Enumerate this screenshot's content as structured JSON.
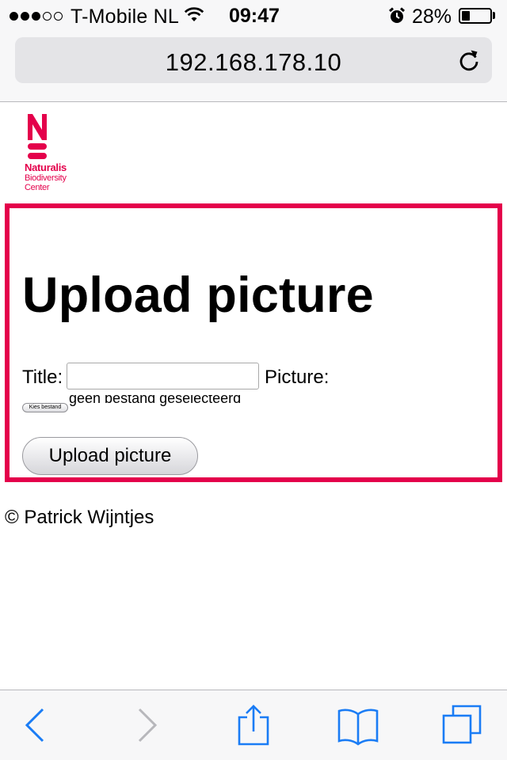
{
  "status_bar": {
    "signal_dots": [
      true,
      true,
      true,
      false,
      false
    ],
    "carrier": "T-Mobile NL",
    "time": "09:47",
    "battery_percent_text": "28%",
    "battery_level": 0.28,
    "icons": [
      "wifi-icon",
      "alarm-icon",
      "battery-icon"
    ]
  },
  "browser": {
    "url": "192.168.178.10",
    "reload_icon": "reload-icon",
    "toolbar_icons": [
      "back-icon",
      "forward-icon",
      "share-icon",
      "bookmarks-icon",
      "tabs-icon"
    ],
    "accent_color": "#1a7cf5",
    "disabled_color": "#b7b7bb"
  },
  "logo": {
    "name": "Naturalis",
    "subtitle_line1": "Biodiversity",
    "subtitle_line2": "Center",
    "color": "#e4004b"
  },
  "form": {
    "heading": "Upload picture",
    "title_label": "Title:",
    "title_value": "",
    "picture_label": "Picture:",
    "choose_file_label": "Kies bestand",
    "file_status": "geen bestand geselecteerd",
    "submit_label": "Upload picture",
    "border_color": "#e4004b"
  },
  "footer": {
    "copyright": "© Patrick Wijntjes"
  }
}
